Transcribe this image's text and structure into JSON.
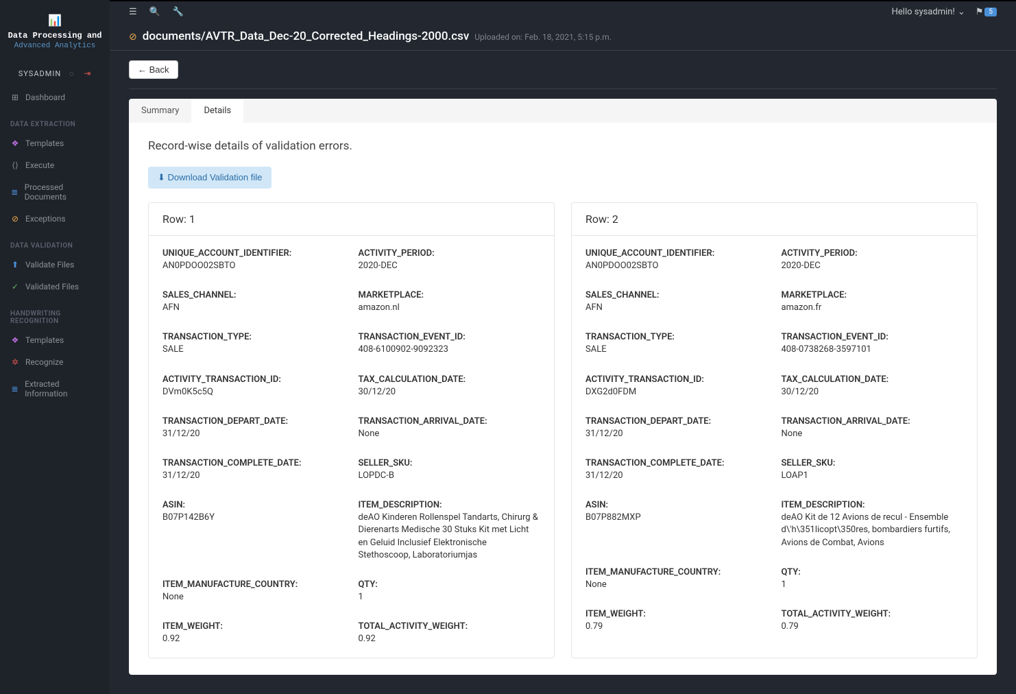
{
  "brand": {
    "line1": "Data Processing and",
    "line2": "Advanced Analytics"
  },
  "sidebar": {
    "user": "SYSADMIN",
    "groups": [
      {
        "heading": null,
        "items": [
          {
            "icon": "⊞",
            "iconClass": "",
            "label": "Dashboard"
          }
        ]
      },
      {
        "heading": "DATA EXTRACTION",
        "items": [
          {
            "icon": "❖",
            "iconClass": "ic-purple",
            "label": "Templates"
          },
          {
            "icon": "⟨⟩",
            "iconClass": "",
            "label": "Execute"
          },
          {
            "icon": "≣",
            "iconClass": "ic-blue",
            "label": "Processed Documents"
          },
          {
            "icon": "⊘",
            "iconClass": "ic-orange",
            "label": "Exceptions"
          }
        ]
      },
      {
        "heading": "DATA VALIDATION",
        "items": [
          {
            "icon": "⬆",
            "iconClass": "ic-blue",
            "label": "Validate Files"
          },
          {
            "icon": "✓",
            "iconClass": "ic-green",
            "label": "Validated Files"
          }
        ]
      },
      {
        "heading": "HANDWRITING RECOGNITION",
        "items": [
          {
            "icon": "❖",
            "iconClass": "ic-purple",
            "label": "Templates"
          },
          {
            "icon": "✲",
            "iconClass": "ic-red",
            "label": "Recognize"
          },
          {
            "icon": "≣",
            "iconClass": "ic-blue",
            "label": "Extracted Information"
          }
        ]
      }
    ]
  },
  "topbar": {
    "greeting": "Hello sysadmin!",
    "badge": "5"
  },
  "header": {
    "title": "documents/AVTR_Data_Dec-20_Corrected_Headings-2000.csv",
    "uploaded": "Uploaded on: Feb. 18, 2021, 5:15 p.m."
  },
  "back": "Back",
  "tabs": {
    "summary": "Summary",
    "details": "Details"
  },
  "panel": {
    "title": "Record-wise details of validation errors.",
    "download": "Download Validation file"
  },
  "rows": [
    {
      "title": "Row: 1",
      "fields": [
        {
          "l": "UNIQUE_ACCOUNT_IDENTIFIER:",
          "v": "AN0PDOO02SBTO"
        },
        {
          "l": "ACTIVITY_PERIOD:",
          "v": "2020-DEC"
        },
        {
          "l": "SALES_CHANNEL:",
          "v": "AFN"
        },
        {
          "l": "MARKETPLACE:",
          "v": "amazon.nl"
        },
        {
          "l": "TRANSACTION_TYPE:",
          "v": "SALE"
        },
        {
          "l": "TRANSACTION_EVENT_ID:",
          "v": "408-6100902-9092323"
        },
        {
          "l": "ACTIVITY_TRANSACTION_ID:",
          "v": "DVm0K5c5Q"
        },
        {
          "l": "TAX_CALCULATION_DATE:",
          "v": "30/12/20"
        },
        {
          "l": "TRANSACTION_DEPART_DATE:",
          "v": "31/12/20"
        },
        {
          "l": "TRANSACTION_ARRIVAL_DATE:",
          "v": "None"
        },
        {
          "l": "TRANSACTION_COMPLETE_DATE:",
          "v": "31/12/20"
        },
        {
          "l": "SELLER_SKU:",
          "v": "LOPDC-B"
        },
        {
          "l": "ASIN:",
          "v": "B07P142B6Y"
        },
        {
          "l": "ITEM_DESCRIPTION:",
          "v": "deAO Kinderen Rollenspel Tandarts, Chirurg & Dierenarts Medische 30 Stuks Kit met Licht en Geluid Inclusief Elektronische Stethoscoop, Laboratoriumjas"
        },
        {
          "l": "ITEM_MANUFACTURE_COUNTRY:",
          "v": "None"
        },
        {
          "l": "QTY:",
          "v": "1"
        },
        {
          "l": "ITEM_WEIGHT:",
          "v": "0.92"
        },
        {
          "l": "TOTAL_ACTIVITY_WEIGHT:",
          "v": "0.92"
        }
      ]
    },
    {
      "title": "Row: 2",
      "fields": [
        {
          "l": "UNIQUE_ACCOUNT_IDENTIFIER:",
          "v": "AN0PDOO02SBTO"
        },
        {
          "l": "ACTIVITY_PERIOD:",
          "v": "2020-DEC"
        },
        {
          "l": "SALES_CHANNEL:",
          "v": "AFN"
        },
        {
          "l": "MARKETPLACE:",
          "v": "amazon.fr"
        },
        {
          "l": "TRANSACTION_TYPE:",
          "v": "SALE"
        },
        {
          "l": "TRANSACTION_EVENT_ID:",
          "v": "408-0738268-3597101"
        },
        {
          "l": "ACTIVITY_TRANSACTION_ID:",
          "v": "DXG2d0FDM"
        },
        {
          "l": "TAX_CALCULATION_DATE:",
          "v": "30/12/20"
        },
        {
          "l": "TRANSACTION_DEPART_DATE:",
          "v": "31/12/20"
        },
        {
          "l": "TRANSACTION_ARRIVAL_DATE:",
          "v": "None"
        },
        {
          "l": "TRANSACTION_COMPLETE_DATE:",
          "v": "31/12/20"
        },
        {
          "l": "SELLER_SKU:",
          "v": "LOAP1"
        },
        {
          "l": "ASIN:",
          "v": "B07P882MXP"
        },
        {
          "l": "ITEM_DESCRIPTION:",
          "v": "deAO Kit de 12 Avions de recul - Ensemble d\\'h\\351licopt\\350res, bombardiers furtifs, Avions de Combat, Avions"
        },
        {
          "l": "ITEM_MANUFACTURE_COUNTRY:",
          "v": "None"
        },
        {
          "l": "QTY:",
          "v": "1"
        },
        {
          "l": "ITEM_WEIGHT:",
          "v": "0.79"
        },
        {
          "l": "TOTAL_ACTIVITY_WEIGHT:",
          "v": "0.79"
        }
      ]
    }
  ]
}
